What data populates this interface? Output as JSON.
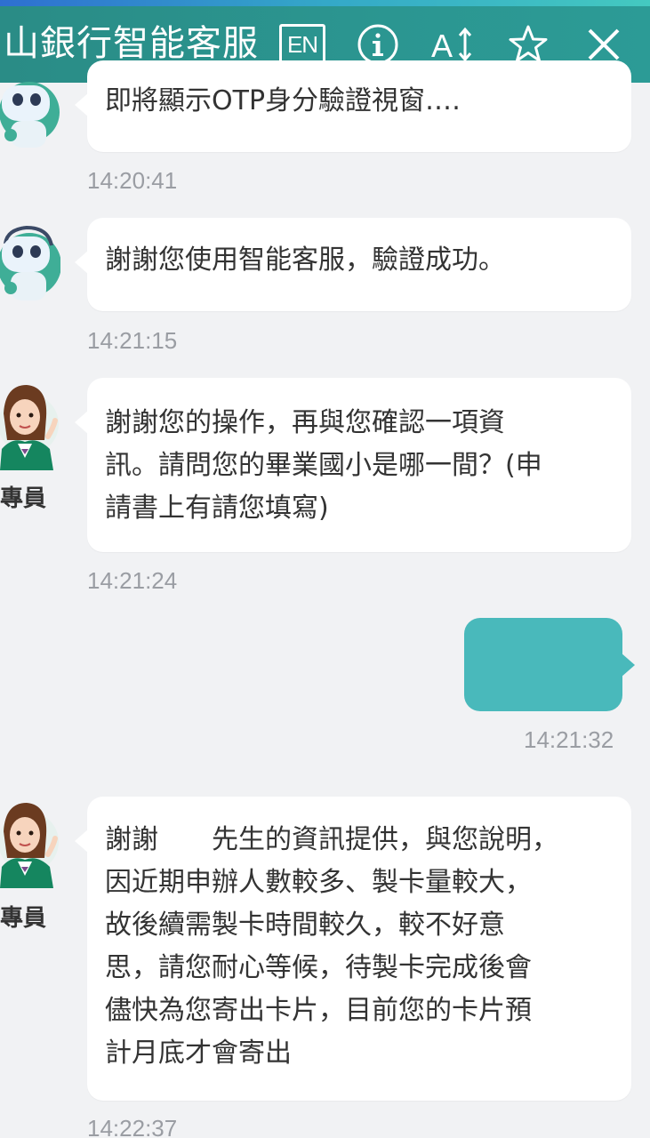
{
  "header": {
    "title": "山銀行智能客服",
    "en_label": "EN",
    "icons": [
      "info-icon",
      "font-size-icon",
      "star-icon",
      "close-icon"
    ]
  },
  "messages": [
    {
      "sender": "bot",
      "text": "即將顯示OTP身分驗證視窗‥‥",
      "time": "14:20:41"
    },
    {
      "sender": "bot",
      "text": "謝謝您使用智能客服，驗證成功。",
      "time": "14:21:15"
    },
    {
      "sender": "agent",
      "label": "專員",
      "lines": [
        "謝謝您的操作，再與您確認一項資",
        "訊。請問您的畢業國小是哪一間？(申",
        "請書上有請您填寫)"
      ],
      "time": "14:21:24"
    },
    {
      "sender": "user",
      "text": "",
      "time": "14:21:32"
    },
    {
      "sender": "agent",
      "label": "專員",
      "lines": [
        "謝謝　　先生的資訊提供，與您說明，",
        "因近期申辦人數較多、製卡量較大，",
        "故後續需製卡時間較久，較不好意",
        "思，請您耐心等候，待製卡完成後會",
        "儘快為您寄出卡片，目前您的卡片預",
        "計月底才會寄出"
      ],
      "time": "14:22:37"
    }
  ],
  "colors": {
    "header": "#2b9691",
    "user_bubble": "#49b9bb",
    "background": "#f1f2f4"
  }
}
